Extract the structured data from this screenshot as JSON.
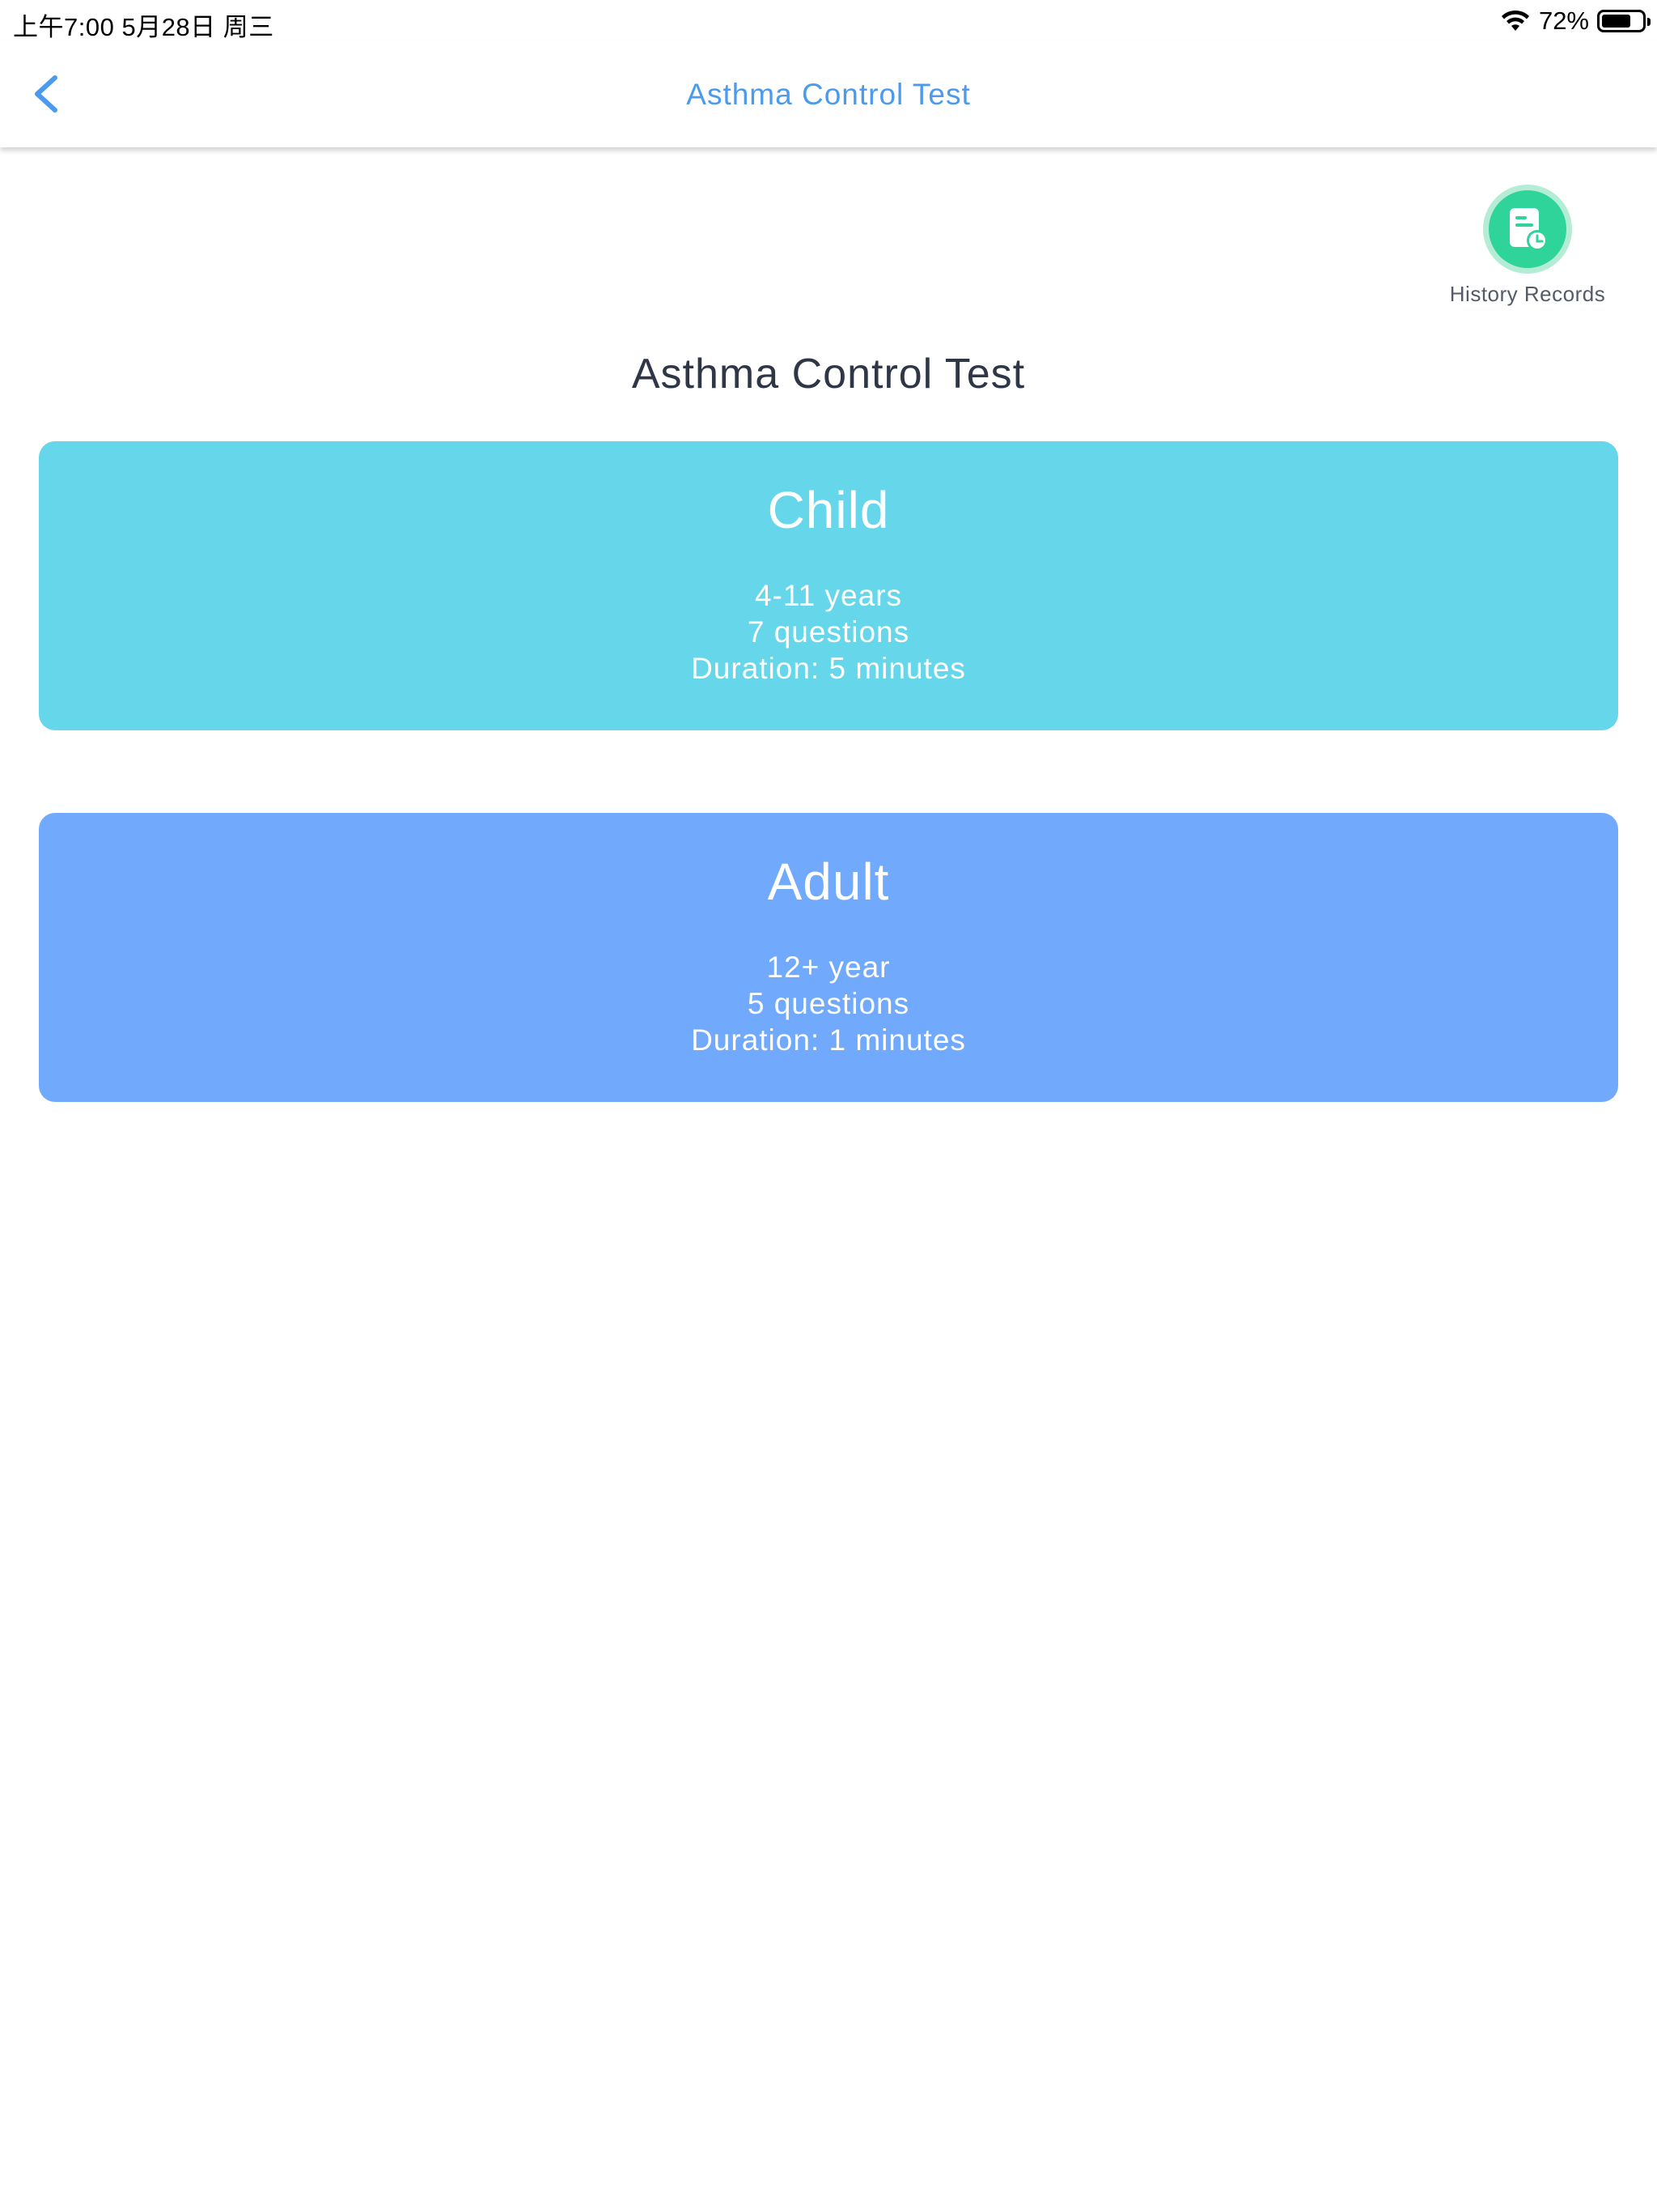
{
  "status_bar": {
    "time": "上午7:00   5月28日 周三",
    "battery_text": "72%",
    "battery_level": 0.72
  },
  "nav": {
    "title": "Asthma Control Test",
    "back_icon": "chevron-left-icon"
  },
  "history": {
    "label": "History Records",
    "icon": "document-clock-icon",
    "color": "#2fd49a"
  },
  "page_title": "Asthma Control Test",
  "tests": [
    {
      "title": "Child",
      "age": "4-11 years",
      "questions": "7 questions",
      "duration": "Duration: 5 minutes",
      "color": "#66d6ea"
    },
    {
      "title": "Adult",
      "age": "12+ year",
      "questions": "5 questions",
      "duration": "Duration: 1 minutes",
      "color": "#71a9fc"
    }
  ]
}
